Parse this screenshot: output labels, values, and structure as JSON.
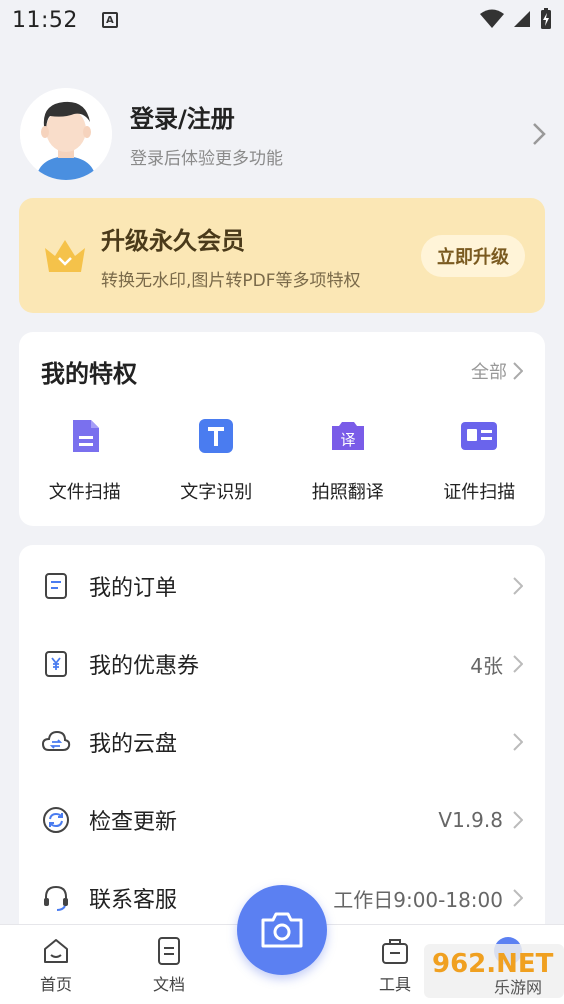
{
  "status": {
    "time": "11:52",
    "notification_letter": "A"
  },
  "profile": {
    "title": "登录/注册",
    "subtitle": "登录后体验更多功能"
  },
  "vip": {
    "title": "升级永久会员",
    "subtitle": "转换无水印,图片转PDF等多项特权",
    "button": "立即升级"
  },
  "privileges": {
    "title": "我的特权",
    "all_label": "全部",
    "items": [
      {
        "label": "文件扫描",
        "icon": "document-scan-icon"
      },
      {
        "label": "文字识别",
        "icon": "text-recognition-icon"
      },
      {
        "label": "拍照翻译",
        "icon": "photo-translate-icon",
        "glyph": "译"
      },
      {
        "label": "证件扫描",
        "icon": "id-card-scan-icon"
      }
    ]
  },
  "menu": [
    {
      "label": "我的订单",
      "value": "",
      "icon": "order-icon"
    },
    {
      "label": "我的优惠券",
      "value": "4张",
      "icon": "coupon-icon"
    },
    {
      "label": "我的云盘",
      "value": "",
      "icon": "cloud-icon"
    },
    {
      "label": "检查更新",
      "value": "V1.9.8",
      "icon": "update-icon"
    },
    {
      "label": "联系客服",
      "value": "工作日9:00-18:00",
      "icon": "customer-service-icon"
    }
  ],
  "nav": {
    "home": "首页",
    "docs": "文档",
    "tools": "工具"
  },
  "watermark": {
    "text": "962.NET",
    "sub": "乐游网"
  },
  "colors": {
    "accent": "#5b80f2",
    "vip_bg": "#fbe7b5",
    "icon_purple": "#7b6cf0"
  }
}
